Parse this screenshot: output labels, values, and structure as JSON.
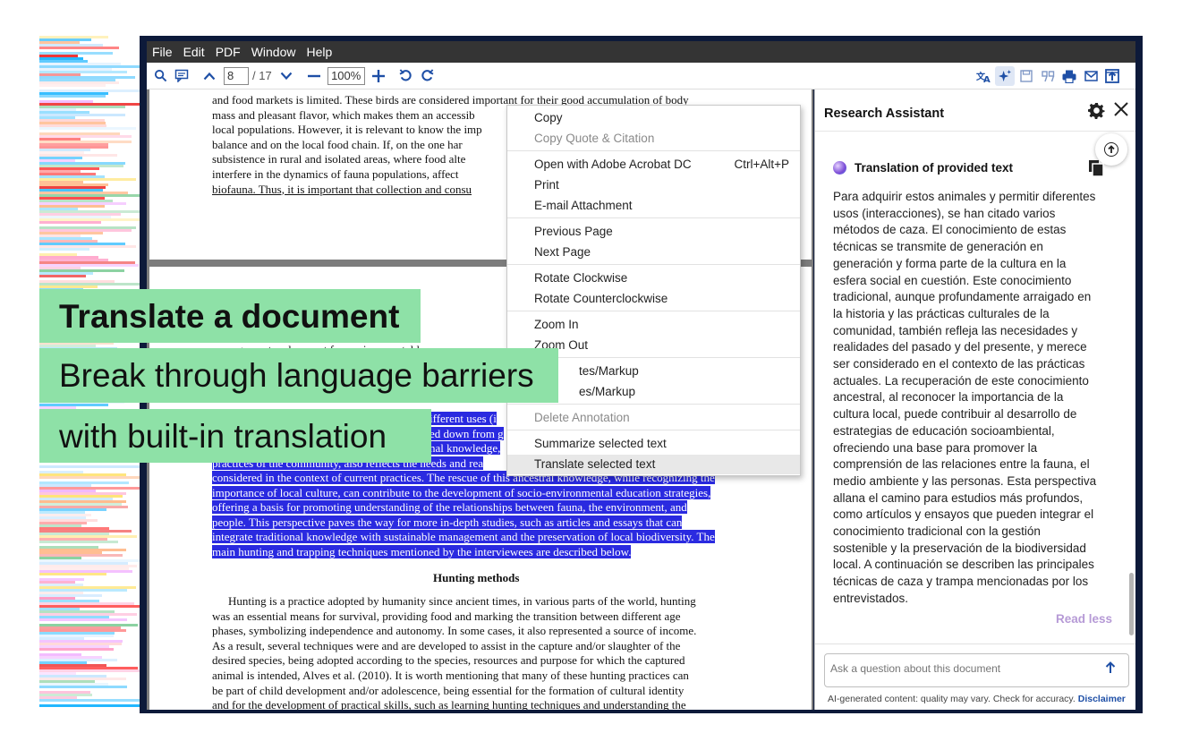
{
  "menubar": [
    "File",
    "Edit",
    "PDF",
    "Window",
    "Help"
  ],
  "toolbar": {
    "page_current": "8",
    "page_total": "/ 17",
    "zoom": "100%"
  },
  "doc": {
    "page1_lines": [
      "and food markets is limited. These birds are considered important for their good accumulation of body",
      "mass and pleasant flavor, which makes them an accessib",
      "local populations. However, it is relevant to know the imp",
      "balance and on the local food chain. If, on the one har",
      "subsistence in rural and isolated areas, where food alte",
      "interfere in the dynamics of fauna populations, affect",
      "biofauna. Thus, it is important that collection and consu"
    ],
    "page2_partial_lines": [
      "management and respect for environmental laws, se"
    ],
    "page2_mid_lines": [
      "ifferent uses (i",
      "ed down from g",
      "nal knowledge,",
      "practices of the community, also reflects the needs and rea"
    ],
    "page2_highlight_lines": [
      "considered in the context of current practices. The rescue of this ancestral knowledge, while recognizing the",
      "importance of local culture, can contribute to the development of socio-environmental education strategies,",
      "offering a basis for promoting understanding of the relationships between fauna, the environment, and",
      "people. This perspective paves the way for more in-depth studies, such as articles and essays that can",
      "integrate traditional knowledge with sustainable management and the preservation of local biodiversity. The",
      "main hunting and trapping techniques mentioned by the interviewees are described below."
    ],
    "heading": "Hunting methods",
    "page2_body_lines": [
      "Hunting is a practice adopted by humanity since ancient times, in various parts of the world, hunting",
      "was an essential means for survival, providing food and marking the transition between different age",
      "phases, symbolizing independence and autonomy. In some cases, it also represented a source of income.",
      "As a result, several techniques were and are developed to assist in the capture and/or slaughter of the",
      "desired species, being adopted according to the species, resources and purpose for which the captured",
      "animal is intended, Alves et al. (2010). It is worth mentioning that many of these hunting practices can",
      "be part of child development and/or adolescence, being essential for the formation of cultural identity",
      "and for the development of practical skills, such as learning hunting techniques and understanding the"
    ]
  },
  "context_menu": {
    "copy": "Copy",
    "copy_quote": "Copy Quote & Citation",
    "open_with": "Open with Adobe Acrobat DC",
    "open_with_shortcut": "Ctrl+Alt+P",
    "print": "Print",
    "email": "E-mail Attachment",
    "prev_page": "Previous Page",
    "next_page": "Next Page",
    "rotate_cw": "Rotate Clockwise",
    "rotate_ccw": "Rotate Counterclockwise",
    "zoom_in": "Zoom In",
    "zoom_out": "Zoom Out",
    "notes_1": "tes/Markup",
    "notes_2": "es/Markup",
    "delete_annotation": "Delete Annotation",
    "summarize": "Summarize selected text",
    "translate": "Translate selected text"
  },
  "assistant": {
    "title": "Research Assistant",
    "translation_title": "Translation of provided text",
    "body_lines": [
      "Para adquirir estos animales y permitir diferentes",
      "usos (interacciones), se han citado varios",
      "métodos de caza. El conocimiento de estas",
      "técnicas se transmite de generación en",
      "generación y forma parte de la cultura en la",
      "esfera social en cuestión. Este conocimiento",
      "tradicional, aunque profundamente arraigado en",
      "la historia y las prácticas culturales de la",
      "comunidad, también refleja las necesidades y",
      "realidades del pasado y del presente, y merece",
      "ser considerado en el contexto de las prácticas",
      "actuales. La recuperación de este conocimiento",
      "ancestral, al reconocer la importancia de la",
      "cultura local, puede contribuir al desarrollo de",
      "estrategias de educación socioambiental,",
      "ofreciendo una base para promover la",
      "comprensión de las relaciones entre la fauna, el",
      "medio ambiente y las personas. Esta perspectiva",
      "allana el camino para estudios más profundos,",
      "como artículos y ensayos que pueden integrar el",
      "conocimiento tradicional con la gestión",
      "sostenible y la preservación de la biodiversidad",
      "local. A continuación se describen las principales",
      "técnicas de caza y trampa mencionadas por los",
      "entrevistados."
    ],
    "read_less": "Read less",
    "ask_placeholder": "Ask a question about this document",
    "footer_text": "AI-generated content: quality may vary. Check for accuracy.",
    "disclaimer": "Disclaimer"
  },
  "banners": {
    "line1": "Translate a document",
    "line2": "Break through language barriers",
    "line3": "with built-in translation"
  },
  "colors": {
    "highlight": "#2a2ae0",
    "banner": "#8ee1a7",
    "accent": "#1e4fa6",
    "read_less": "#b69ad6"
  }
}
